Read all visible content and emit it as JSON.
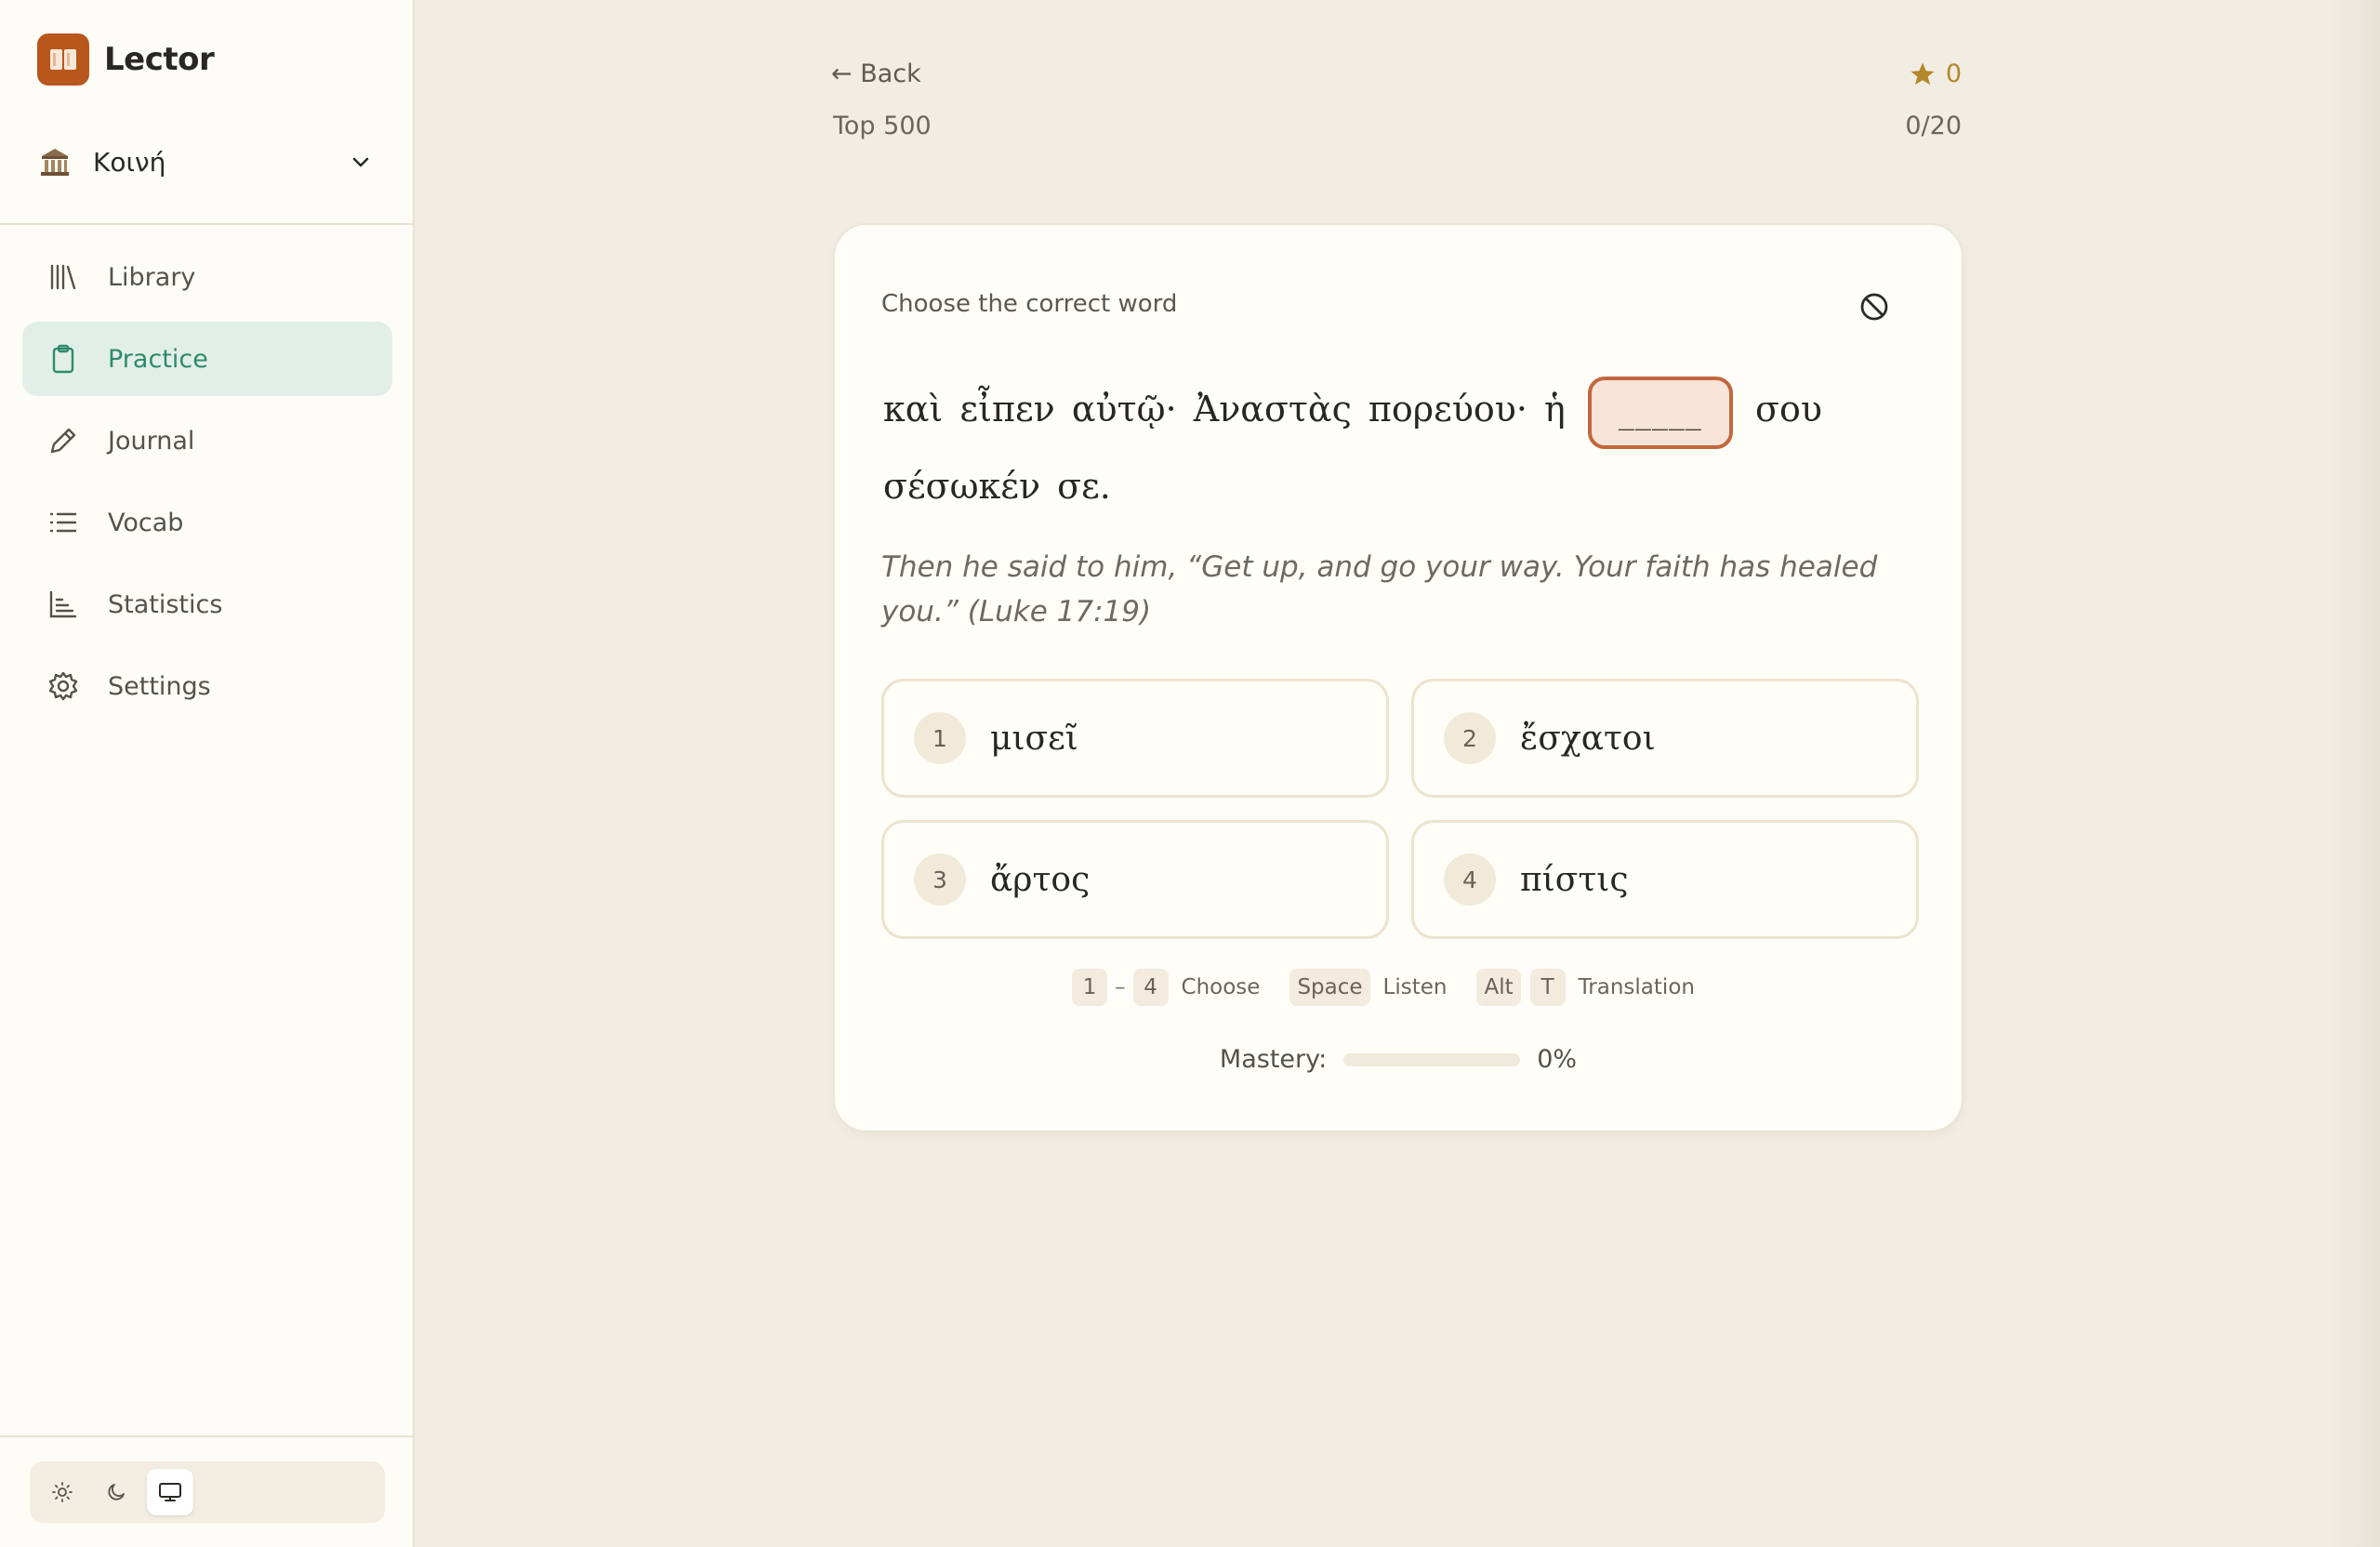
{
  "app": {
    "name": "Lector",
    "logo_icon": "book-icon"
  },
  "language": {
    "label": "Κοινή",
    "icon": "columns-building-icon"
  },
  "nav": {
    "items": [
      {
        "label": "Library",
        "icon": "library-icon",
        "active": false
      },
      {
        "label": "Practice",
        "icon": "clipboard-icon",
        "active": true
      },
      {
        "label": "Journal",
        "icon": "pencil-icon",
        "active": false
      },
      {
        "label": "Vocab",
        "icon": "list-icon",
        "active": false
      },
      {
        "label": "Statistics",
        "icon": "bar-chart-icon",
        "active": false
      },
      {
        "label": "Settings",
        "icon": "gear-icon",
        "active": false
      }
    ]
  },
  "theme": {
    "options": [
      "light",
      "dark",
      "system"
    ],
    "selected": "system"
  },
  "header": {
    "back_label": "← Back",
    "deck_name": "Top 500",
    "score": "0",
    "progress": "0/20"
  },
  "card": {
    "prompt": "Choose the correct word",
    "sentence_before": "καὶ εἶπεν αὐτῷ· Ἀναστὰς πορεύου· ἡ",
    "blank": "_____",
    "sentence_after": "σου σέσωκέν σε.",
    "translation": "Then he said to him, “Get up, and go your way. Your faith has healed you.” (Luke 17:19)",
    "options": [
      {
        "num": "1",
        "word": "μισεῖ"
      },
      {
        "num": "2",
        "word": "ἔσχατοι"
      },
      {
        "num": "3",
        "word": "ἄρτος"
      },
      {
        "num": "4",
        "word": "πίστις"
      }
    ],
    "shortcuts": {
      "range_start": "1",
      "range_sep": "–",
      "range_end": "4",
      "choose_label": "Choose",
      "space_key": "Space",
      "listen_label": "Listen",
      "alt_key": "Alt",
      "t_key": "T",
      "translation_label": "Translation"
    },
    "mastery": {
      "label": "Mastery:",
      "value": "0%",
      "fraction": 0
    }
  },
  "colors": {
    "accent": "#2e8a6c",
    "brand": "#b8561c",
    "blank_border": "#c2673e",
    "star": "#b4882c"
  }
}
